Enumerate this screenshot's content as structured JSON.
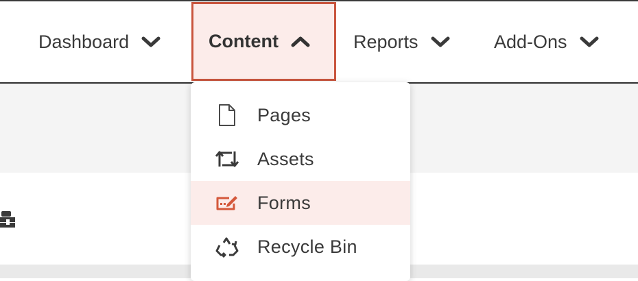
{
  "nav": {
    "dashboard": "Dashboard",
    "content": "Content",
    "reports": "Reports",
    "addons": "Add-Ons",
    "active": "Content"
  },
  "content_menu": {
    "items": [
      {
        "label": "Pages",
        "icon": "file-icon"
      },
      {
        "label": "Assets",
        "icon": "crop-arrows-icon"
      },
      {
        "label": "Forms",
        "icon": "form-edit-icon",
        "highlighted": true
      },
      {
        "label": "Recycle Bin",
        "icon": "recycle-icon"
      }
    ]
  },
  "colors": {
    "accent": "#c9553e",
    "highlight": "#fcecea",
    "text": "#3a3a3a"
  }
}
